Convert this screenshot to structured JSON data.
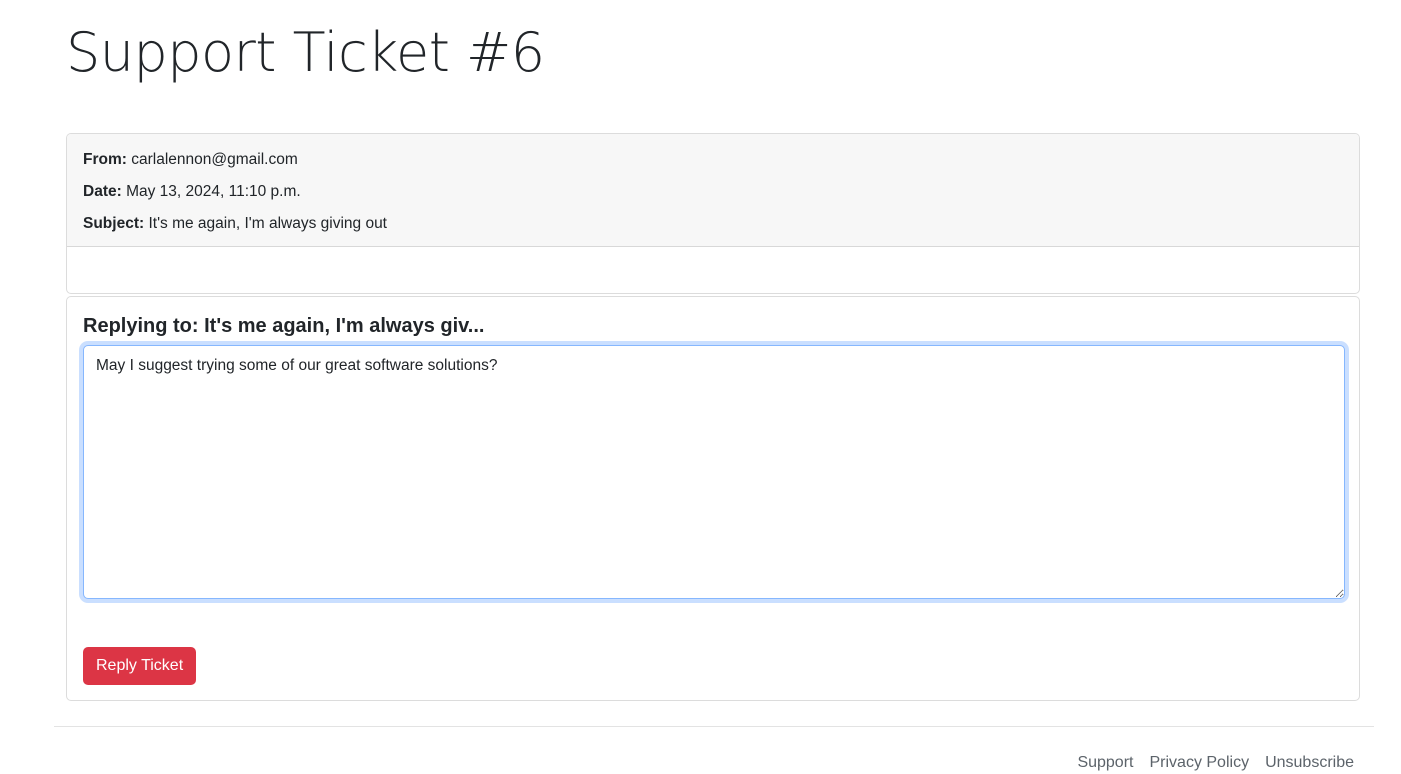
{
  "page": {
    "title": "Support Ticket #6"
  },
  "ticket": {
    "from_label": "From:",
    "from_value": "carlalennon@gmail.com",
    "date_label": "Date:",
    "date_value": "May 13, 2024, 11:10 p.m.",
    "subject_label": "Subject:",
    "subject_value": "It's me again, I'm always giving out",
    "body": ""
  },
  "reply": {
    "heading": "Replying to: It's me again, I'm always giv...",
    "text": "May I suggest trying some of our great software solutions?",
    "button_label": "Reply Ticket"
  },
  "footer": {
    "links": [
      "Support",
      "Privacy Policy",
      "Unsubscribe"
    ]
  },
  "colors": {
    "button_bg": "#dc3545",
    "header_bg": "#f7f7f7",
    "focus_ring": "#86b7fe"
  }
}
